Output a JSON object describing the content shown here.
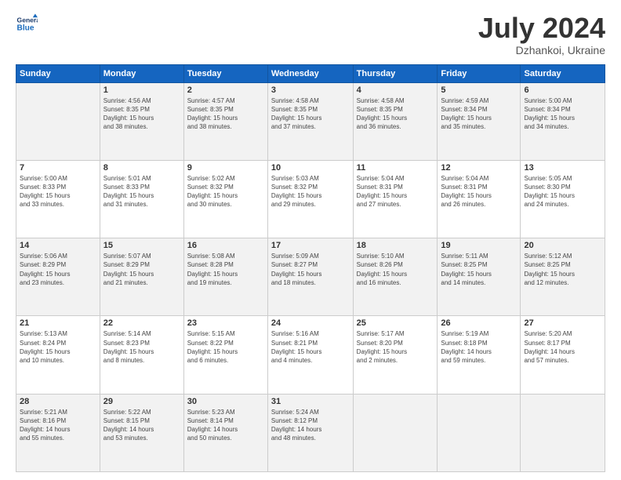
{
  "logo": {
    "line1": "General",
    "line2": "Blue"
  },
  "title": "July 2024",
  "location": "Dzhankoi, Ukraine",
  "days_header": [
    "Sunday",
    "Monday",
    "Tuesday",
    "Wednesday",
    "Thursday",
    "Friday",
    "Saturday"
  ],
  "weeks": [
    [
      {
        "day": "",
        "sunrise": "",
        "sunset": "",
        "daylight": ""
      },
      {
        "day": "1",
        "sunrise": "Sunrise: 4:56 AM",
        "sunset": "Sunset: 8:35 PM",
        "daylight": "Daylight: 15 hours and 38 minutes."
      },
      {
        "day": "2",
        "sunrise": "Sunrise: 4:57 AM",
        "sunset": "Sunset: 8:35 PM",
        "daylight": "Daylight: 15 hours and 38 minutes."
      },
      {
        "day": "3",
        "sunrise": "Sunrise: 4:58 AM",
        "sunset": "Sunset: 8:35 PM",
        "daylight": "Daylight: 15 hours and 37 minutes."
      },
      {
        "day": "4",
        "sunrise": "Sunrise: 4:58 AM",
        "sunset": "Sunset: 8:35 PM",
        "daylight": "Daylight: 15 hours and 36 minutes."
      },
      {
        "day": "5",
        "sunrise": "Sunrise: 4:59 AM",
        "sunset": "Sunset: 8:34 PM",
        "daylight": "Daylight: 15 hours and 35 minutes."
      },
      {
        "day": "6",
        "sunrise": "Sunrise: 5:00 AM",
        "sunset": "Sunset: 8:34 PM",
        "daylight": "Daylight: 15 hours and 34 minutes."
      }
    ],
    [
      {
        "day": "7",
        "sunrise": "Sunrise: 5:00 AM",
        "sunset": "Sunset: 8:33 PM",
        "daylight": "Daylight: 15 hours and 33 minutes."
      },
      {
        "day": "8",
        "sunrise": "Sunrise: 5:01 AM",
        "sunset": "Sunset: 8:33 PM",
        "daylight": "Daylight: 15 hours and 31 minutes."
      },
      {
        "day": "9",
        "sunrise": "Sunrise: 5:02 AM",
        "sunset": "Sunset: 8:32 PM",
        "daylight": "Daylight: 15 hours and 30 minutes."
      },
      {
        "day": "10",
        "sunrise": "Sunrise: 5:03 AM",
        "sunset": "Sunset: 8:32 PM",
        "daylight": "Daylight: 15 hours and 29 minutes."
      },
      {
        "day": "11",
        "sunrise": "Sunrise: 5:04 AM",
        "sunset": "Sunset: 8:31 PM",
        "daylight": "Daylight: 15 hours and 27 minutes."
      },
      {
        "day": "12",
        "sunrise": "Sunrise: 5:04 AM",
        "sunset": "Sunset: 8:31 PM",
        "daylight": "Daylight: 15 hours and 26 minutes."
      },
      {
        "day": "13",
        "sunrise": "Sunrise: 5:05 AM",
        "sunset": "Sunset: 8:30 PM",
        "daylight": "Daylight: 15 hours and 24 minutes."
      }
    ],
    [
      {
        "day": "14",
        "sunrise": "Sunrise: 5:06 AM",
        "sunset": "Sunset: 8:29 PM",
        "daylight": "Daylight: 15 hours and 23 minutes."
      },
      {
        "day": "15",
        "sunrise": "Sunrise: 5:07 AM",
        "sunset": "Sunset: 8:29 PM",
        "daylight": "Daylight: 15 hours and 21 minutes."
      },
      {
        "day": "16",
        "sunrise": "Sunrise: 5:08 AM",
        "sunset": "Sunset: 8:28 PM",
        "daylight": "Daylight: 15 hours and 19 minutes."
      },
      {
        "day": "17",
        "sunrise": "Sunrise: 5:09 AM",
        "sunset": "Sunset: 8:27 PM",
        "daylight": "Daylight: 15 hours and 18 minutes."
      },
      {
        "day": "18",
        "sunrise": "Sunrise: 5:10 AM",
        "sunset": "Sunset: 8:26 PM",
        "daylight": "Daylight: 15 hours and 16 minutes."
      },
      {
        "day": "19",
        "sunrise": "Sunrise: 5:11 AM",
        "sunset": "Sunset: 8:25 PM",
        "daylight": "Daylight: 15 hours and 14 minutes."
      },
      {
        "day": "20",
        "sunrise": "Sunrise: 5:12 AM",
        "sunset": "Sunset: 8:25 PM",
        "daylight": "Daylight: 15 hours and 12 minutes."
      }
    ],
    [
      {
        "day": "21",
        "sunrise": "Sunrise: 5:13 AM",
        "sunset": "Sunset: 8:24 PM",
        "daylight": "Daylight: 15 hours and 10 minutes."
      },
      {
        "day": "22",
        "sunrise": "Sunrise: 5:14 AM",
        "sunset": "Sunset: 8:23 PM",
        "daylight": "Daylight: 15 hours and 8 minutes."
      },
      {
        "day": "23",
        "sunrise": "Sunrise: 5:15 AM",
        "sunset": "Sunset: 8:22 PM",
        "daylight": "Daylight: 15 hours and 6 minutes."
      },
      {
        "day": "24",
        "sunrise": "Sunrise: 5:16 AM",
        "sunset": "Sunset: 8:21 PM",
        "daylight": "Daylight: 15 hours and 4 minutes."
      },
      {
        "day": "25",
        "sunrise": "Sunrise: 5:17 AM",
        "sunset": "Sunset: 8:20 PM",
        "daylight": "Daylight: 15 hours and 2 minutes."
      },
      {
        "day": "26",
        "sunrise": "Sunrise: 5:19 AM",
        "sunset": "Sunset: 8:18 PM",
        "daylight": "Daylight: 14 hours and 59 minutes."
      },
      {
        "day": "27",
        "sunrise": "Sunrise: 5:20 AM",
        "sunset": "Sunset: 8:17 PM",
        "daylight": "Daylight: 14 hours and 57 minutes."
      }
    ],
    [
      {
        "day": "28",
        "sunrise": "Sunrise: 5:21 AM",
        "sunset": "Sunset: 8:16 PM",
        "daylight": "Daylight: 14 hours and 55 minutes."
      },
      {
        "day": "29",
        "sunrise": "Sunrise: 5:22 AM",
        "sunset": "Sunset: 8:15 PM",
        "daylight": "Daylight: 14 hours and 53 minutes."
      },
      {
        "day": "30",
        "sunrise": "Sunrise: 5:23 AM",
        "sunset": "Sunset: 8:14 PM",
        "daylight": "Daylight: 14 hours and 50 minutes."
      },
      {
        "day": "31",
        "sunrise": "Sunrise: 5:24 AM",
        "sunset": "Sunset: 8:12 PM",
        "daylight": "Daylight: 14 hours and 48 minutes."
      },
      {
        "day": "",
        "sunrise": "",
        "sunset": "",
        "daylight": ""
      },
      {
        "day": "",
        "sunrise": "",
        "sunset": "",
        "daylight": ""
      },
      {
        "day": "",
        "sunrise": "",
        "sunset": "",
        "daylight": ""
      }
    ]
  ]
}
